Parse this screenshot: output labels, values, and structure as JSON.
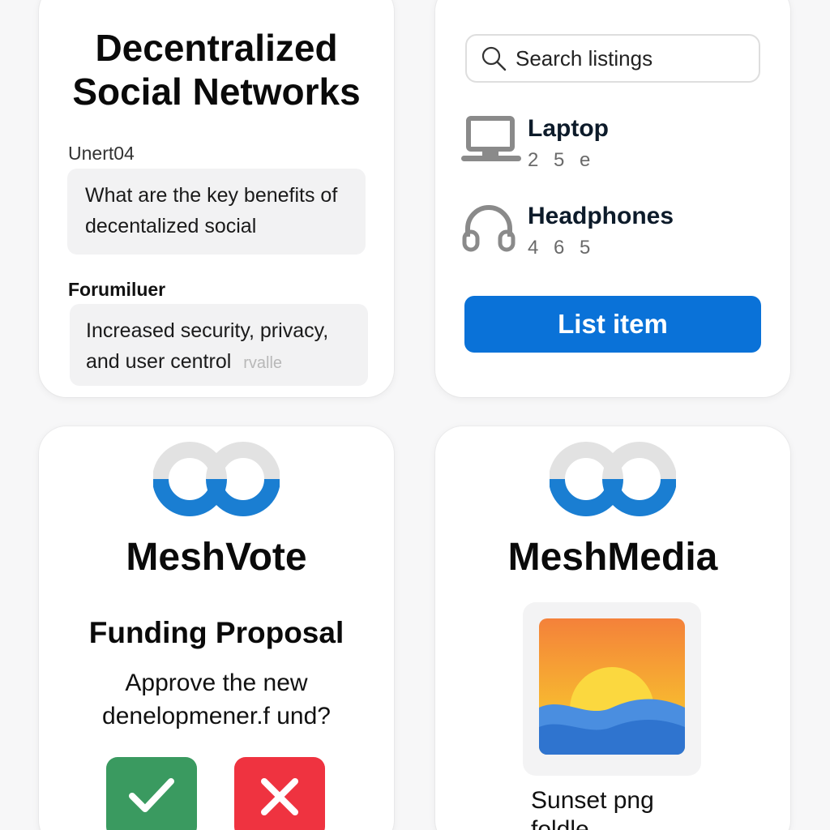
{
  "forum": {
    "title_line1": "Decentralized",
    "title_line2": "Social Networks",
    "posts": [
      {
        "user": "Unert04",
        "text": "What are the key benefits of decentalized social"
      },
      {
        "user": "Forumiluer",
        "text": "Increased security, privacy, and user centrol",
        "tag": "rvalle"
      }
    ]
  },
  "market": {
    "search": {
      "placeholder": "Search listings"
    },
    "listings": [
      {
        "name": "Laptop",
        "price": "2 5 e",
        "icon": "laptop-icon"
      },
      {
        "name": "Headphones",
        "price": "4 6 5",
        "icon": "headphones-icon"
      }
    ],
    "action_label": "List item"
  },
  "vote": {
    "app_name": "MeshVote",
    "proposal_title": "Funding Proposal",
    "proposal_text_line1": "Approve the new",
    "proposal_text_line2": "denelopmener.f und?",
    "approve_icon": "checkmark-icon",
    "reject_icon": "x-icon"
  },
  "media": {
    "app_name": "MeshMedia",
    "file_name": "Sunset png",
    "file_sub": "foldle"
  },
  "colors": {
    "accent": "#0a72d8",
    "approve": "#3a9a60",
    "reject": "#ef3340",
    "logo_gray": "#e2e2e2",
    "logo_blue": "#1a7ed2"
  }
}
